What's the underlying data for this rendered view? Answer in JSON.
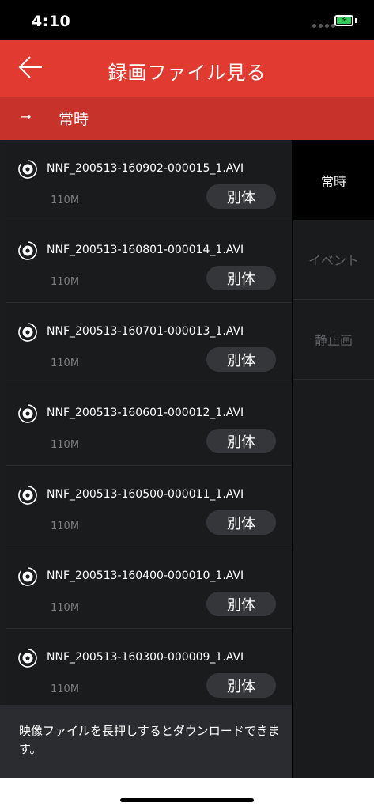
{
  "status_bar": {
    "time": "4:10",
    "battery_icon": "battery-charging-icon",
    "signal_icon": "signal-dots-icon"
  },
  "header": {
    "title": "録画ファイル見る",
    "back_icon": "arrow-left-icon",
    "color": "#e13a30"
  },
  "subheader": {
    "arrow": "→",
    "title": "常時",
    "color": "#c7322a"
  },
  "files": [
    {
      "name": "NNF_200513-160902-000015_1.AVI",
      "size": "110M",
      "button": "別体"
    },
    {
      "name": "NNF_200513-160801-000014_1.AVI",
      "size": "110M",
      "button": "別体"
    },
    {
      "name": "NNF_200513-160701-000013_1.AVI",
      "size": "110M",
      "button": "別体"
    },
    {
      "name": "NNF_200513-160601-000012_1.AVI",
      "size": "110M",
      "button": "別体"
    },
    {
      "name": "NNF_200513-160500-000011_1.AVI",
      "size": "110M",
      "button": "別体"
    },
    {
      "name": "NNF_200513-160400-000010_1.AVI",
      "size": "110M",
      "button": "別体"
    },
    {
      "name": "NNF_200513-160300-000009_1.AVI",
      "size": "110M",
      "button": "別体"
    }
  ],
  "file_icon": "video-disc-icon",
  "sidebar": {
    "items": [
      {
        "label": "常時",
        "active": true
      },
      {
        "label": "イベント",
        "active": false
      },
      {
        "label": "静止画",
        "active": false
      }
    ]
  },
  "notice": "映像ファイルを長押しするとダウンロードできます。"
}
